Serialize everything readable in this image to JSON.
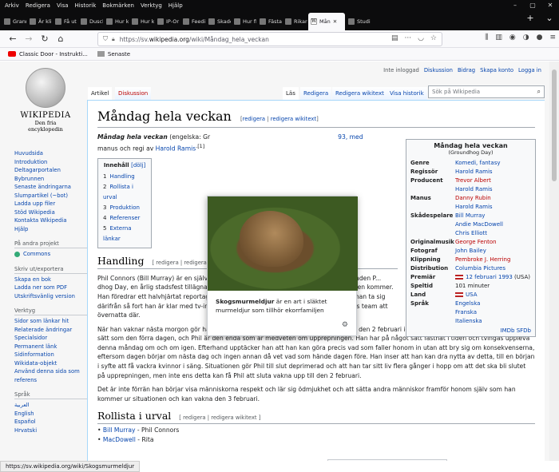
{
  "menubar": [
    "Arkiv",
    "Redigera",
    "Visa",
    "Historik",
    "Bokmärken",
    "Verktyg",
    "Hjälp"
  ],
  "tabs": [
    "Grann",
    "Är kli",
    "Få ut",
    "Dusch",
    "Hur k",
    "Hur k",
    "IP-Or",
    "Feedi",
    "Skade",
    "Hur fi",
    "Fästa",
    "Rikare",
    "Mån",
    "Studi"
  ],
  "url": {
    "prefix": "https://sv.",
    "domain": "wikipedia.org",
    "path": "/wiki/Måndag_hela_veckan"
  },
  "bookmarks": [
    "Classic Door - Instrukti...",
    "Senaste"
  ],
  "personal": [
    "Inte inloggad",
    "Diskussion",
    "Bidrag",
    "Skapa konto",
    "Logga in"
  ],
  "wtabs": {
    "article": "Artikel",
    "talk": "Diskussion",
    "read": "Läs",
    "edit": "Redigera",
    "edit_wiki": "Redigera wikitext",
    "history": "Visa historik",
    "search_placeholder": "Sök på Wikipedia"
  },
  "logo": {
    "title": "WIKIPEDIA",
    "subtitle": "Den fria encyklopedin"
  },
  "sidebar": {
    "main": [
      "Huvudsida",
      "Introduktion",
      "Deltagarportalen",
      "Bybrunnen",
      "Senaste ändringarna",
      "Slumpartikel (~bot)",
      "Ladda upp filer",
      "Stöd Wikipedia",
      "Kontakta Wikipedia",
      "Hjälp"
    ],
    "other_head": "På andra projekt",
    "commons": "Commons",
    "print_head": "Skriv ut/exportera",
    "print": [
      "Skapa en bok",
      "Ladda ner som PDF",
      "Utskriftsvänlig version"
    ],
    "tools_head": "Verktyg",
    "tools": [
      "Sidor som länkar hit",
      "Relaterade ändringar",
      "Specialsidor",
      "Permanent länk",
      "Sidinformation",
      "Wikidata-objekt",
      "Använd denna sida som referens"
    ],
    "lang_head": "Språk",
    "langs": [
      "العربية",
      "English",
      "Español",
      "Hrvatski"
    ]
  },
  "content": {
    "title": "Måndag hela veckan",
    "edit_links": [
      "redigera",
      "redigera wikitext"
    ],
    "intro_1": "Måndag hela veckan",
    "intro_2": " (engelska: Gr",
    "intro_3": "93, med",
    "intro_4": "manus och regi av ",
    "intro_director": "Harold Ramis",
    "intro_ref": ".[1]",
    "toc_title": "Innehåll",
    "toc_hide": "[dölj]",
    "toc": [
      {
        "n": "1",
        "t": "Handling"
      },
      {
        "n": "2",
        "t": "Rollista i urval"
      },
      {
        "n": "3",
        "t": "Produktion"
      },
      {
        "n": "4",
        "t": "Referenser"
      },
      {
        "n": "5",
        "t": "Externa länkar"
      }
    ],
    "h_handling": "Handling",
    "h_edit": "[ redigera | redigera wi",
    "p1": "Phil Connors (Bill Murray) är en självisk ... andagen den 2 februari är han i den lilla staden P... dhog Day, en årlig stadsfest tillägnad ett skogsmurmeldjur som sägs förutspå när våren kommer. Han föredrar ett halvhjärtat reportage av festivalen. Eftersom han avskyr staden vill han ta sig därifrån så fort han är klar med tv-inslaget, men en snöstorm tvingar honom och hans team att övernatta där.",
    "p2": "När han vaknar nästa morgon gör han den märkliga upptäckten att det är måndagen den 2 februari igen. Allting utspelar sig på precis samma sätt som den förra dagen, och Phil är den enda som är medveten om upprepningen. Han har på något sätt fastnat i tiden och tvingas uppleva denna måndag om och om igen. Efterhand upptäcker han att han kan göra precis vad som faller honom in utan att bry sig om konsekvenserna, eftersom dagen börjar om nästa dag och ingen annan då vet vad som hände dagen före. Han inser att han kan dra nytta av detta, till en början i syfte att få vackra kvinnor i säng. Situationen gör Phil till slut deprimerad och att han tar sitt liv flera gånger i hopp om att det ska bli slutet på upprepningen, men inte ens detta kan få Phil att sluta vakna upp till den 2 februari.",
    "p3": "Det är inte förrän han börjar visa människorna respekt och lär sig ödmjukhet och att sätta andra människor framför honom själv som han kommer ur situationen och kan vakna den 3 februari.",
    "h_rollista": "Rollista i urval",
    "h_rollista_edit": "[ redigera | redigera wikitext ]",
    "cast_1_actor": "Bill Murray",
    "cast_1_role": " - Phil Connors",
    "cast_2_actor": "MacDowell",
    "cast_2_role": " - Rita"
  },
  "infobox": {
    "title": "Måndag hela veckan",
    "subtitle": "(Groundhog Day)",
    "rows": [
      {
        "k": "Genre",
        "v": [
          "Komedi, fantasy"
        ]
      },
      {
        "k": "Regissör",
        "v": [
          "Harold Ramis"
        ]
      },
      {
        "k": "Producent",
        "v": [
          "Trevor Albert",
          "Harold Ramis"
        ]
      },
      {
        "k": "Manus",
        "v": [
          "Danny Rubin",
          "Harold Ramis"
        ]
      },
      {
        "k": "Skådespelare",
        "v": [
          "Bill Murray",
          "Andie MacDowell",
          "Chris Elliott"
        ]
      },
      {
        "k": "Originalmusik",
        "v": [
          "George Fenton"
        ]
      },
      {
        "k": "Fotograf",
        "v": [
          "John Bailey"
        ]
      },
      {
        "k": "Klippning",
        "v": [
          "Pembroke J. Herring"
        ]
      },
      {
        "k": "Distribution",
        "v": [
          "Columbia Pictures"
        ]
      }
    ],
    "premiere_label": "Premiär",
    "premiere_date": "12 februari 1993",
    "premiere_country": " (USA)",
    "runtime_label": "Speltid",
    "runtime": "101 minuter",
    "country_label": "Land",
    "country": "USA",
    "lang_label": "Språk",
    "langs": [
      "Engelska",
      "Franska",
      "Italienska"
    ],
    "links": "IMDb SFDb"
  },
  "popup": {
    "title": "Skogsmurmeldjur",
    "text": " är en art i släktet murmeldjur som tillhör ekorrfamiljen"
  },
  "status": "https://sv.wikipedia.org/wiki/Skogsmurmeldjur"
}
